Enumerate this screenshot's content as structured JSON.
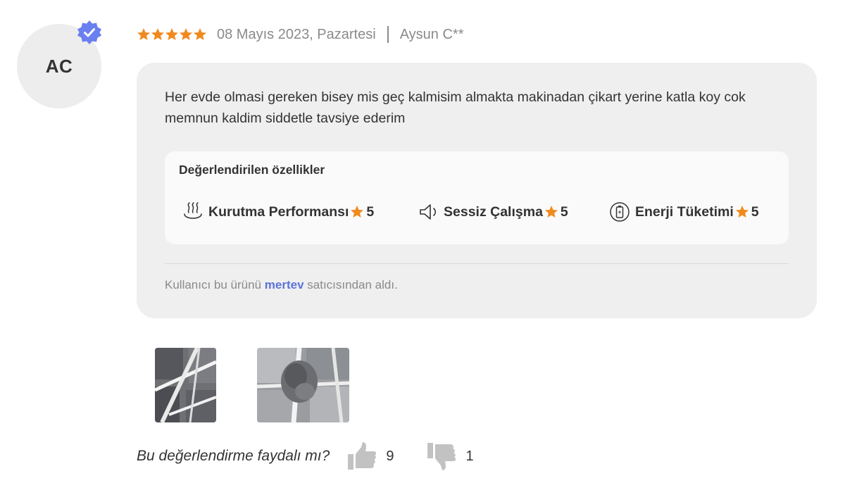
{
  "review": {
    "avatar_initials": "AC",
    "rating": 5,
    "date": "08 Mayıs 2023, Pazartesi",
    "author": "Aysun C**",
    "text": "Her evde olmasi gereken bisey mis geç kalmisim almakta makinadan çikart yerine katla koy cok memnun kaldim siddetle tavsiye ederim",
    "features_title": "Değerlendirilen özellikler",
    "features": [
      {
        "label": "Kurutma Performansı",
        "score": "5",
        "icon": "steam-icon"
      },
      {
        "label": "Sessiz Çalışma",
        "score": "5",
        "icon": "speaker-icon"
      },
      {
        "label": "Enerji Tüketimi",
        "score": "5",
        "icon": "battery-icon"
      }
    ],
    "seller_prefix": "Kullanıcı bu ürünü",
    "seller_name": "mertev",
    "seller_suffix": "satıcısından aldı."
  },
  "helpful": {
    "question": "Bu değerlendirme faydalı mı?",
    "up_count": "9",
    "down_count": "1"
  },
  "colors": {
    "star": "#f08a1f",
    "verified_badge": "#6a7ff0",
    "seller_link": "#5b74d9",
    "card_background": "#efefef"
  }
}
